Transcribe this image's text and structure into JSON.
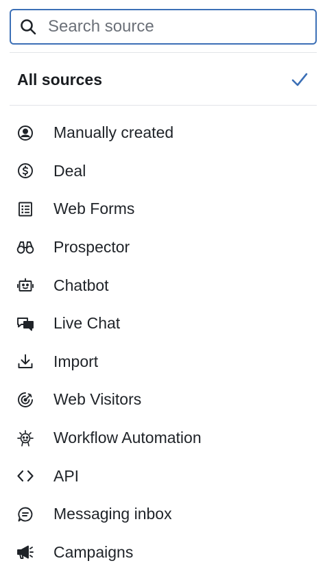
{
  "search": {
    "placeholder": "Search source",
    "value": ""
  },
  "all_sources": {
    "label": "All sources",
    "selected": true
  },
  "sources": [
    {
      "label": "Manually created",
      "icon": "user-circle-icon"
    },
    {
      "label": "Deal",
      "icon": "dollar-circle-icon"
    },
    {
      "label": "Web Forms",
      "icon": "form-list-icon"
    },
    {
      "label": "Prospector",
      "icon": "binoculars-icon"
    },
    {
      "label": "Chatbot",
      "icon": "robot-icon"
    },
    {
      "label": "Live Chat",
      "icon": "chat-bubbles-icon"
    },
    {
      "label": "Import",
      "icon": "download-icon"
    },
    {
      "label": "Web Visitors",
      "icon": "target-icon"
    },
    {
      "label": "Workflow Automation",
      "icon": "automation-robot-icon"
    },
    {
      "label": "API",
      "icon": "code-brackets-icon"
    },
    {
      "label": "Messaging inbox",
      "icon": "message-circle-icon"
    },
    {
      "label": "Campaigns",
      "icon": "megaphone-icon"
    }
  ],
  "colors": {
    "accent": "#3b6fb6",
    "text": "#1f2328",
    "placeholder": "#6b7078",
    "divider": "#e2e4e8"
  }
}
